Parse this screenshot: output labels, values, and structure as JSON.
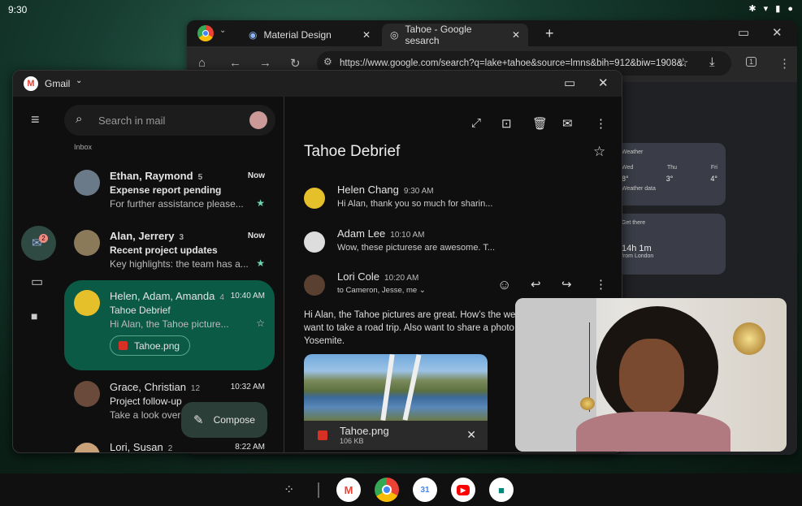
{
  "status": {
    "time": "9:30",
    "icons": "bluetooth wifi battery"
  },
  "chrome": {
    "tabs": [
      {
        "label": "Material Design"
      },
      {
        "label": "Tahoe - Google sesarch"
      }
    ],
    "url": "https://www.google.com/search?q=lake+tahoe&source=lmns&bih=912&biw=1908&",
    "tab_count": "1",
    "weather": {
      "title": "Weather",
      "days": [
        {
          "day": "Wed",
          "temp": "8°"
        },
        {
          "day": "Thu",
          "temp": "3°"
        },
        {
          "day": "Fri",
          "temp": "4°"
        }
      ],
      "footer": "Weather data"
    },
    "get_there": {
      "title": "Get there",
      "duration": "14h 1m",
      "from": "from London"
    }
  },
  "gmail": {
    "app_title": "Gmail",
    "search_placeholder": "Search in mail",
    "section": "Inbox",
    "mail_badge": "2",
    "threads": [
      {
        "names": "Ethan, Raymond",
        "count": "5",
        "time": "Now",
        "subject": "Expense report pending",
        "snippet": "For further assistance please...",
        "starred": true,
        "unread": true
      },
      {
        "names": "Alan, Jerrery",
        "count": "3",
        "time": "Now",
        "subject": "Recent project updates",
        "snippet": "Key highlights: the team has a...",
        "starred": true,
        "unread": true
      },
      {
        "names": "Helen, Adam, Amanda",
        "count": "4",
        "time": "10:40 AM",
        "subject": "Tahoe Debrief",
        "snippet": "Hi Alan, the Tahoe picture...",
        "attachment": "Tahoe.png",
        "starred": false,
        "selected": true
      },
      {
        "names": "Grace, Christian",
        "count": "12",
        "time": "10:32 AM",
        "subject": "Project follow-up",
        "snippet": "Take a look over the",
        "starred": false
      },
      {
        "names": "Lori, Susan",
        "count": "2",
        "time": "8:22 AM"
      }
    ],
    "compose": "Compose",
    "reader": {
      "subject": "Tahoe Debrief",
      "messages": [
        {
          "from": "Helen Chang",
          "time": "9:30 AM",
          "snippet": "Hi Alan, thank you so much for sharin..."
        },
        {
          "from": "Adam Lee",
          "time": "10:10 AM",
          "snippet": "Wow, these picturese are awesome. T..."
        },
        {
          "from": "Lori Cole",
          "time": "10:20 AM",
          "to": "to Cameron, Jesse, me"
        }
      ],
      "body": [
        "Hi Alan, the Tahoe pictures are great. How’s the weat",
        "want to take a road trip. Also want to share a photo I",
        "Yosemite."
      ],
      "attachment": {
        "name": "Tahoe.png",
        "size": "106 KB"
      }
    }
  },
  "colors": {
    "selected": "#0b5a45",
    "star": "#6dd5b0",
    "badge": "#f28b82"
  }
}
